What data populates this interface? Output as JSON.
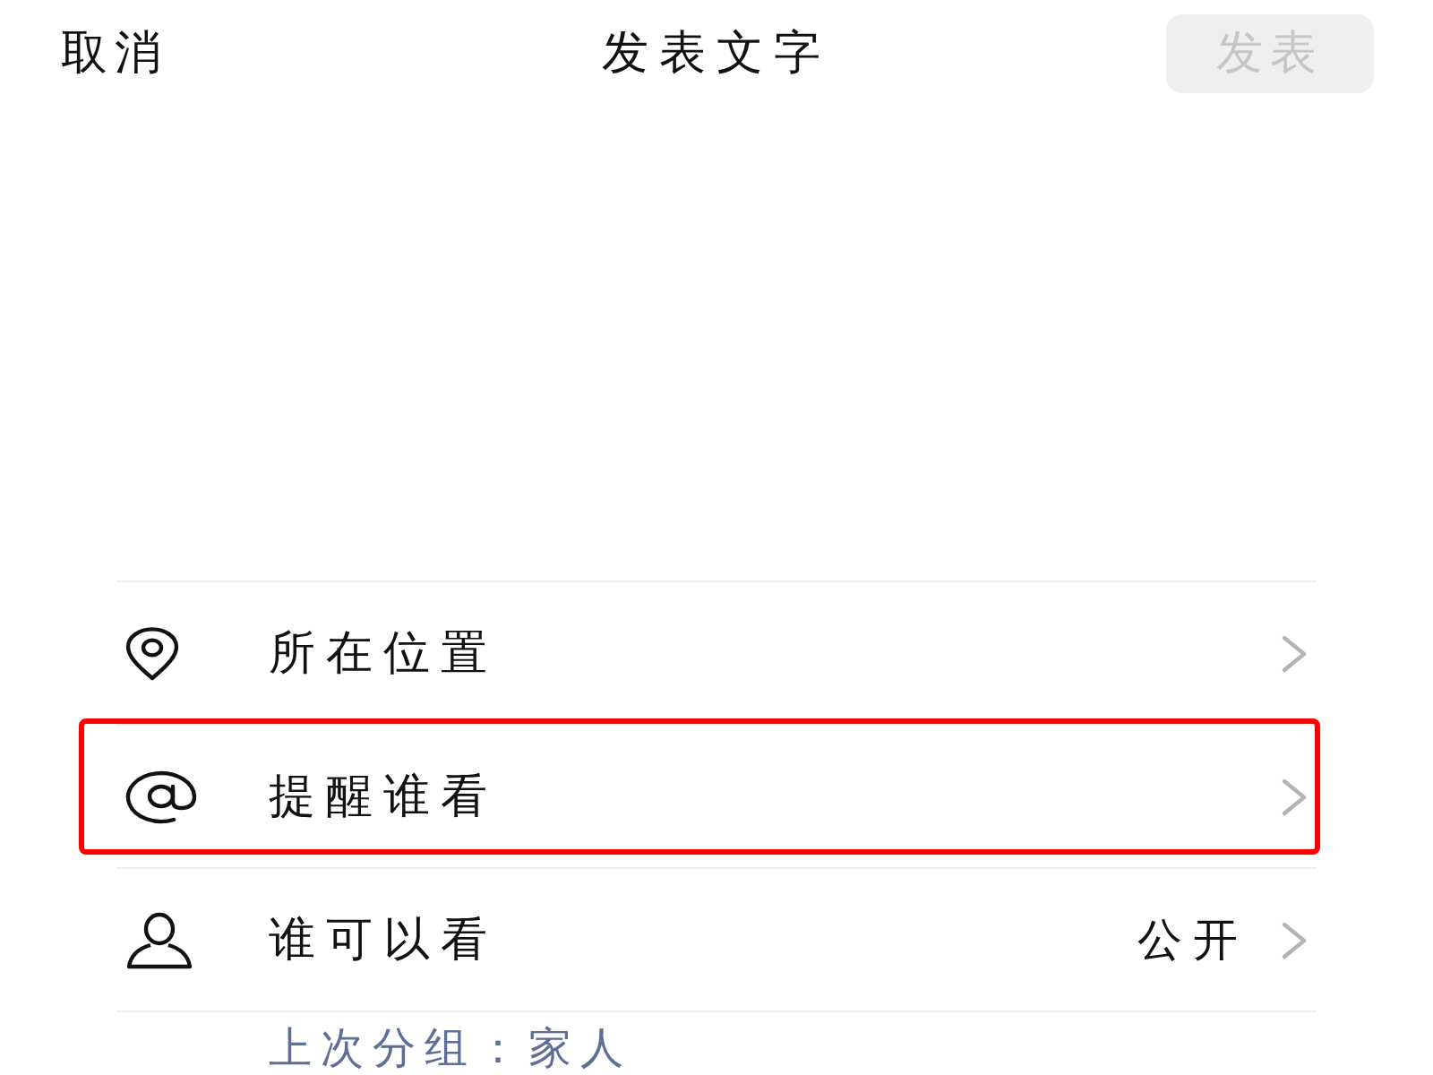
{
  "header": {
    "cancel": "取消",
    "title": "发表文字",
    "publish_button": {
      "label": "发表",
      "disabled": true
    }
  },
  "options": [
    {
      "label": "所在位置",
      "highlighted": false
    },
    {
      "label": "提醒谁看",
      "highlighted": true
    },
    {
      "label": "谁可以看",
      "value": "公开",
      "highlighted": false
    }
  ],
  "footer_note": "上次分组：家人"
}
